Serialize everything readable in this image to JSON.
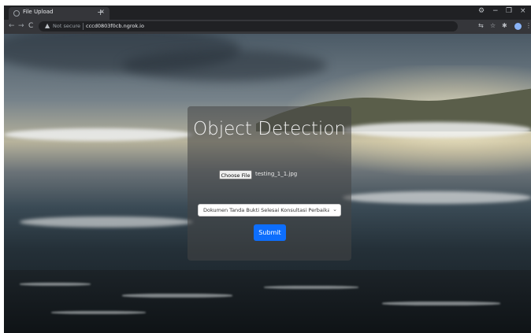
{
  "browser": {
    "tab_title": "File Upload",
    "tab_close": "×",
    "new_tab": "+",
    "window_controls": {
      "minimize": "−",
      "maximize": "❐",
      "close": "×"
    },
    "nav": {
      "back": "←",
      "forward": "→",
      "reload": "C"
    },
    "security_label": "Not secure",
    "url": "cccd0803f0cb.ngrok.io",
    "icons": [
      "translate-icon",
      "star-icon",
      "extensions-icon",
      "profile-icon",
      "menu-icon"
    ]
  },
  "page": {
    "title": "Object Detection",
    "file_input": {
      "button_label": "Choose File",
      "file_name": "testing_1_1.jpg"
    },
    "select": {
      "selected": "Dokumen Tanda Bukti Selesai Konsultasi Perbaikan Fisik"
    },
    "submit_label": "Submit"
  },
  "colors": {
    "accent": "#0d6efd",
    "panel": "rgba(70,70,70,0.55)",
    "browser_dark": "#202124"
  }
}
